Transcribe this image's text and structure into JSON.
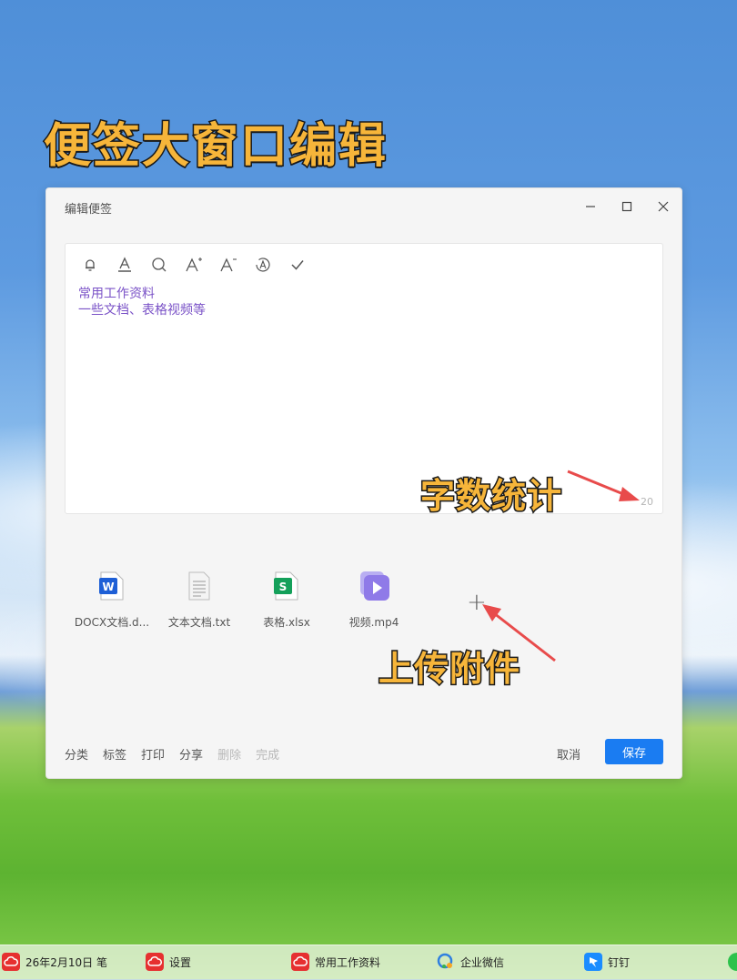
{
  "headline": "便签大窗口编辑",
  "window": {
    "title": "编辑便签",
    "controls": {
      "minimize": "—",
      "maximize": "☐",
      "close": "✕"
    }
  },
  "editor": {
    "lines": [
      "常用工作资料",
      "一些文档、表格视频等"
    ],
    "word_count": "20",
    "text_color": "#7a52c7"
  },
  "attachments": [
    {
      "name": "DOCX文档.d...",
      "icon": "word-icon",
      "badge": "W",
      "color": "#1e5fd6"
    },
    {
      "name": "文本文档.txt",
      "icon": "text-file-icon",
      "badge": "",
      "color": "#bfbfbf"
    },
    {
      "name": "表格.xlsx",
      "icon": "spreadsheet-icon",
      "badge": "S",
      "color": "#14a05a"
    },
    {
      "name": "视频.mp4",
      "icon": "video-icon",
      "badge": "",
      "color": "#8f7ae8"
    }
  ],
  "add_attachment": "+",
  "footer": {
    "actions": [
      "分类",
      "标签",
      "打印",
      "分享",
      "删除",
      "完成"
    ],
    "cancel": "取消",
    "save": "保存"
  },
  "callouts": {
    "word_count": "字数统计",
    "upload": "上传附件"
  },
  "taskbar": [
    {
      "label": "26年2月10日 笔",
      "icon": "cloud-note-icon",
      "color": "#e63030"
    },
    {
      "label": "设置",
      "icon": "cloud-note-icon",
      "color": "#e63030"
    },
    {
      "label": "常用工作资料",
      "icon": "cloud-note-icon",
      "color": "#e63030"
    },
    {
      "label": "企业微信",
      "icon": "wecom-icon",
      "color": "#2f7fe0"
    },
    {
      "label": "钉钉",
      "icon": "dingtalk-icon",
      "color": "#1a8cff"
    }
  ],
  "colors": {
    "accent": "#1a7cf2",
    "callout": "#f6b53a",
    "arrow": "#e84b4b"
  }
}
